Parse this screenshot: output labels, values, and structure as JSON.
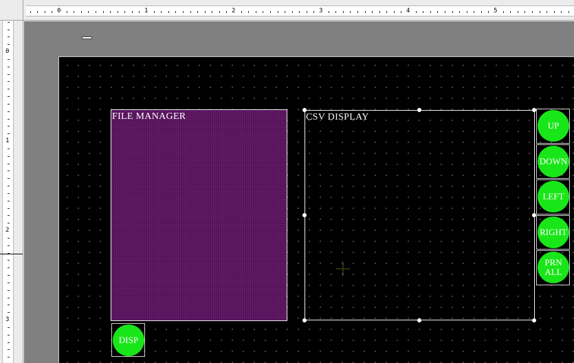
{
  "ruler": {
    "top_labels": [
      "0",
      "1",
      "2",
      "3",
      "4",
      "5"
    ],
    "left_labels": [
      "0",
      "1",
      "2",
      "3"
    ]
  },
  "screen": {
    "file_manager": {
      "title": "FILE MANAGER"
    },
    "csv_display": {
      "title": "CSV DISPLAY"
    },
    "buttons": {
      "up": "UP",
      "down": "DOWN",
      "left": "LEFT",
      "right": "RIGHT",
      "print_all_line1": "PRN",
      "print_all_line2": "ALL",
      "disp": "DISP"
    }
  },
  "colors": {
    "canvas": "#000000",
    "workspace": "#808080",
    "file_manager_fill": "#55125a",
    "button_fill": "#19e619"
  },
  "icons": [
    "crosshair-icon"
  ]
}
